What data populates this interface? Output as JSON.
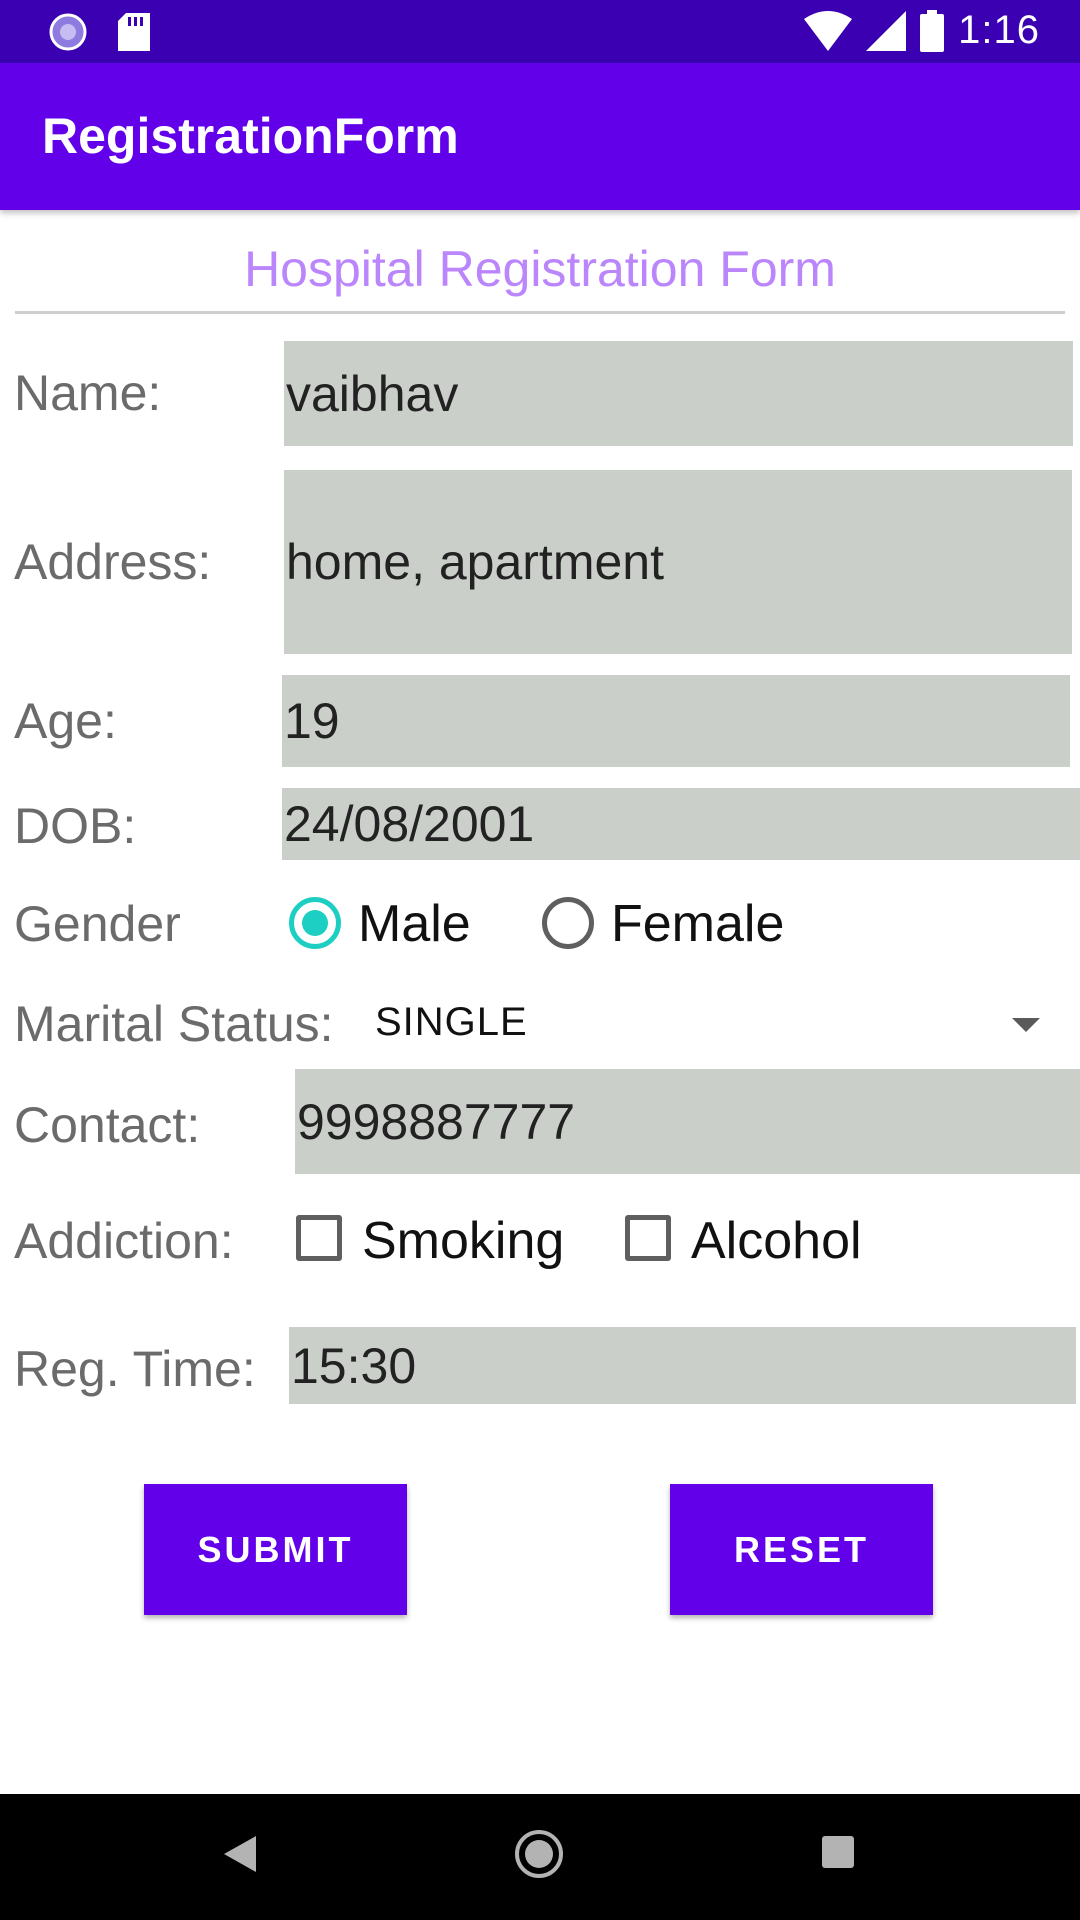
{
  "status_bar": {
    "time": "1:16"
  },
  "app_bar": {
    "title": "RegistrationForm"
  },
  "form": {
    "title": "Hospital Registration Form",
    "name": {
      "label": "Name:",
      "value": "vaibhav"
    },
    "address": {
      "label": "Address:",
      "value": "home, apartment"
    },
    "age": {
      "label": "Age:",
      "value": "19"
    },
    "dob": {
      "label": "DOB:",
      "value": "24/08/2001"
    },
    "gender": {
      "label": "Gender",
      "options": [
        "Male",
        "Female"
      ],
      "selected": "Male"
    },
    "marital_status": {
      "label": "Marital Status:",
      "value": "SINGLE"
    },
    "contact": {
      "label": "Contact:",
      "value": "9998887777"
    },
    "addiction": {
      "label": "Addiction:",
      "options": [
        "Smoking",
        "Alcohol"
      ],
      "checked": []
    },
    "reg_time": {
      "label": "Reg. Time:",
      "value": "15:30"
    }
  },
  "buttons": {
    "submit": "SUBMIT",
    "reset": "RESET"
  },
  "colors": {
    "status_bar": "#3a00b1",
    "app_bar": "#6200ea",
    "accent": "#1ccfc2",
    "title_text": "#bb86fc",
    "field_bg": "#cbcfca"
  }
}
